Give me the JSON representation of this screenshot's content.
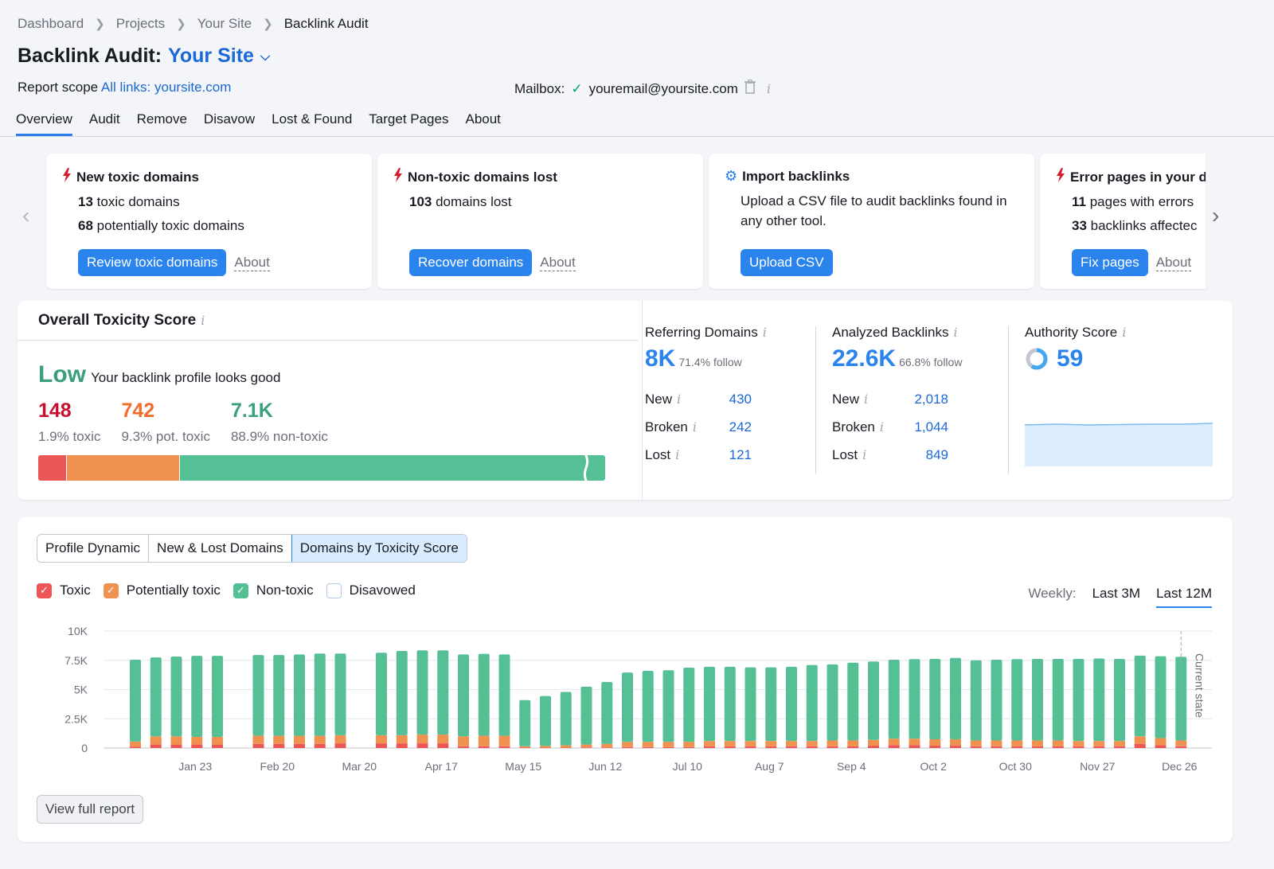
{
  "breadcrumb": [
    "Dashboard",
    "Projects",
    "Your Site",
    "Backlink Audit"
  ],
  "header": {
    "title_prefix": "Backlink Audit:",
    "title_site": "Your Site",
    "scope_label": "Report scope",
    "scope_value": "All links: yoursite.com",
    "mailbox_label": "Mailbox:",
    "mailbox_email": "youremail@yoursite.com"
  },
  "tabs": [
    "Overview",
    "Audit",
    "Remove",
    "Disavow",
    "Lost & Found",
    "Target Pages",
    "About"
  ],
  "active_tab": "Overview",
  "cards": [
    {
      "icon": "bolt",
      "title": "New toxic domains",
      "lines": [
        {
          "num": "13",
          "text": " toxic domains"
        },
        {
          "num": "68",
          "text": " potentially toxic domains"
        }
      ],
      "button": "Review toxic domains",
      "about": "About"
    },
    {
      "icon": "bolt",
      "title": "Non-toxic domains lost",
      "lines": [
        {
          "num": "103",
          "text": " domains lost"
        }
      ],
      "button": "Recover domains",
      "about": "About"
    },
    {
      "icon": "gear",
      "title": "Import backlinks",
      "desc": "Upload a CSV file to audit backlinks found in any other tool.",
      "button": "Upload CSV"
    },
    {
      "icon": "bolt",
      "title": "Error pages in your d",
      "lines": [
        {
          "num": "11",
          "text": " pages with errors"
        },
        {
          "num": "33",
          "text": " backlinks affectec"
        }
      ],
      "button": "Fix pages",
      "about": "About"
    }
  ],
  "toxicity": {
    "title": "Overall Toxicity Score",
    "level": "Low",
    "message": "Your backlink profile looks good",
    "toxic": {
      "value": "148",
      "label": "1.9% toxic",
      "pct": 1.9,
      "color": "#c8102e"
    },
    "pot_toxic": {
      "value": "742",
      "label": "9.3% pot. toxic",
      "pct": 9.3,
      "color": "#f26b2c"
    },
    "non_toxic": {
      "value": "7.1K",
      "label": "88.9% non-toxic",
      "pct": 88.9,
      "color": "#3a9f7c"
    }
  },
  "referring_domains": {
    "title": "Referring Domains",
    "value": "8K",
    "follow": "71.4% follow",
    "rows": [
      {
        "k": "New",
        "v": "430"
      },
      {
        "k": "Broken",
        "v": "242"
      },
      {
        "k": "Lost",
        "v": "121"
      }
    ]
  },
  "analyzed_backlinks": {
    "title": "Analyzed Backlinks",
    "value": "22.6K",
    "follow": "66.8% follow",
    "rows": [
      {
        "k": "New",
        "v": "2,018"
      },
      {
        "k": "Broken",
        "v": "1,044"
      },
      {
        "k": "Lost",
        "v": "849"
      }
    ]
  },
  "authority_score": {
    "title": "Authority Score",
    "value": "59",
    "fraction": 0.59
  },
  "chart_section": {
    "tabs": [
      "Profile Dynamic",
      "New & Lost Domains",
      "Domains by Toxicity Score"
    ],
    "active_tab": "Domains by Toxicity Score",
    "legend": [
      {
        "label": "Toxic",
        "color": "#ec5656",
        "checked": true
      },
      {
        "label": "Potentially toxic",
        "color": "#f0924f",
        "checked": true
      },
      {
        "label": "Non-toxic",
        "color": "#55bf95",
        "checked": true
      },
      {
        "label": "Disavowed",
        "color": "#ffffff",
        "checked": false
      }
    ],
    "range_label": "Weekly:",
    "range_options": [
      "Last 3M",
      "Last 12M"
    ],
    "active_range": "Last 12M",
    "view_full_report": "View full report"
  },
  "chart_data": {
    "type": "bar",
    "stacked": true,
    "title": "Domains by Toxicity Score",
    "ylim": [
      0,
      10000
    ],
    "yticks": [
      "0",
      "2.5K",
      "5K",
      "7.5K",
      "10K"
    ],
    "ytick_values": [
      0,
      2500,
      5000,
      7500,
      10000
    ],
    "xtick_labels": [
      "Jan 23",
      "Feb 20",
      "Mar 20",
      "Apr 17",
      "May 15",
      "Jun 12",
      "Jul 10",
      "Aug 7",
      "Sep 4",
      "Oct 2",
      "Oct 30",
      "Nov 27",
      "Dec 26"
    ],
    "xtick_slot_index": [
      3,
      7,
      11,
      15,
      19,
      23,
      27,
      31,
      35,
      39,
      43,
      47,
      51
    ],
    "annotation": "Current state",
    "grid": true,
    "series_names": [
      "Toxic",
      "Potentially toxic",
      "Non-toxic"
    ],
    "slots": [
      [
        100,
        450,
        7000
      ],
      [
        300,
        700,
        6750
      ],
      [
        300,
        700,
        6820
      ],
      [
        300,
        650,
        6930
      ],
      [
        300,
        650,
        6930
      ],
      null,
      [
        350,
        700,
        6900
      ],
      [
        350,
        700,
        6900
      ],
      [
        350,
        700,
        6950
      ],
      [
        350,
        700,
        7030
      ],
      [
        400,
        700,
        6980
      ],
      null,
      [
        400,
        700,
        7050
      ],
      [
        400,
        700,
        7200
      ],
      [
        400,
        750,
        7200
      ],
      [
        400,
        750,
        7200
      ],
      [
        150,
        850,
        7000
      ],
      [
        150,
        900,
        7000
      ],
      [
        150,
        900,
        6950
      ],
      [
        30,
        120,
        3950
      ],
      [
        30,
        150,
        4270
      ],
      [
        30,
        200,
        4570
      ],
      [
        50,
        250,
        4950
      ],
      [
        50,
        300,
        5300
      ],
      [
        80,
        450,
        5920
      ],
      [
        80,
        450,
        6070
      ],
      [
        80,
        450,
        6120
      ],
      [
        80,
        450,
        6340
      ],
      [
        150,
        450,
        6350
      ],
      [
        150,
        450,
        6350
      ],
      [
        150,
        450,
        6300
      ],
      [
        150,
        450,
        6300
      ],
      [
        150,
        450,
        6350
      ],
      [
        150,
        450,
        6500
      ],
      [
        150,
        500,
        6500
      ],
      [
        150,
        500,
        6650
      ],
      [
        200,
        500,
        6700
      ],
      [
        250,
        550,
        6750
      ],
      [
        250,
        550,
        6800
      ],
      [
        200,
        550,
        6870
      ],
      [
        200,
        550,
        6950
      ],
      [
        150,
        500,
        6850
      ],
      [
        150,
        500,
        6900
      ],
      [
        150,
        500,
        6950
      ],
      [
        150,
        500,
        6970
      ],
      [
        150,
        500,
        6970
      ],
      [
        150,
        450,
        7020
      ],
      [
        150,
        450,
        7050
      ],
      [
        150,
        450,
        7020
      ],
      [
        350,
        650,
        6900
      ],
      [
        250,
        600,
        7000
      ],
      [
        150,
        500,
        7150
      ]
    ]
  }
}
